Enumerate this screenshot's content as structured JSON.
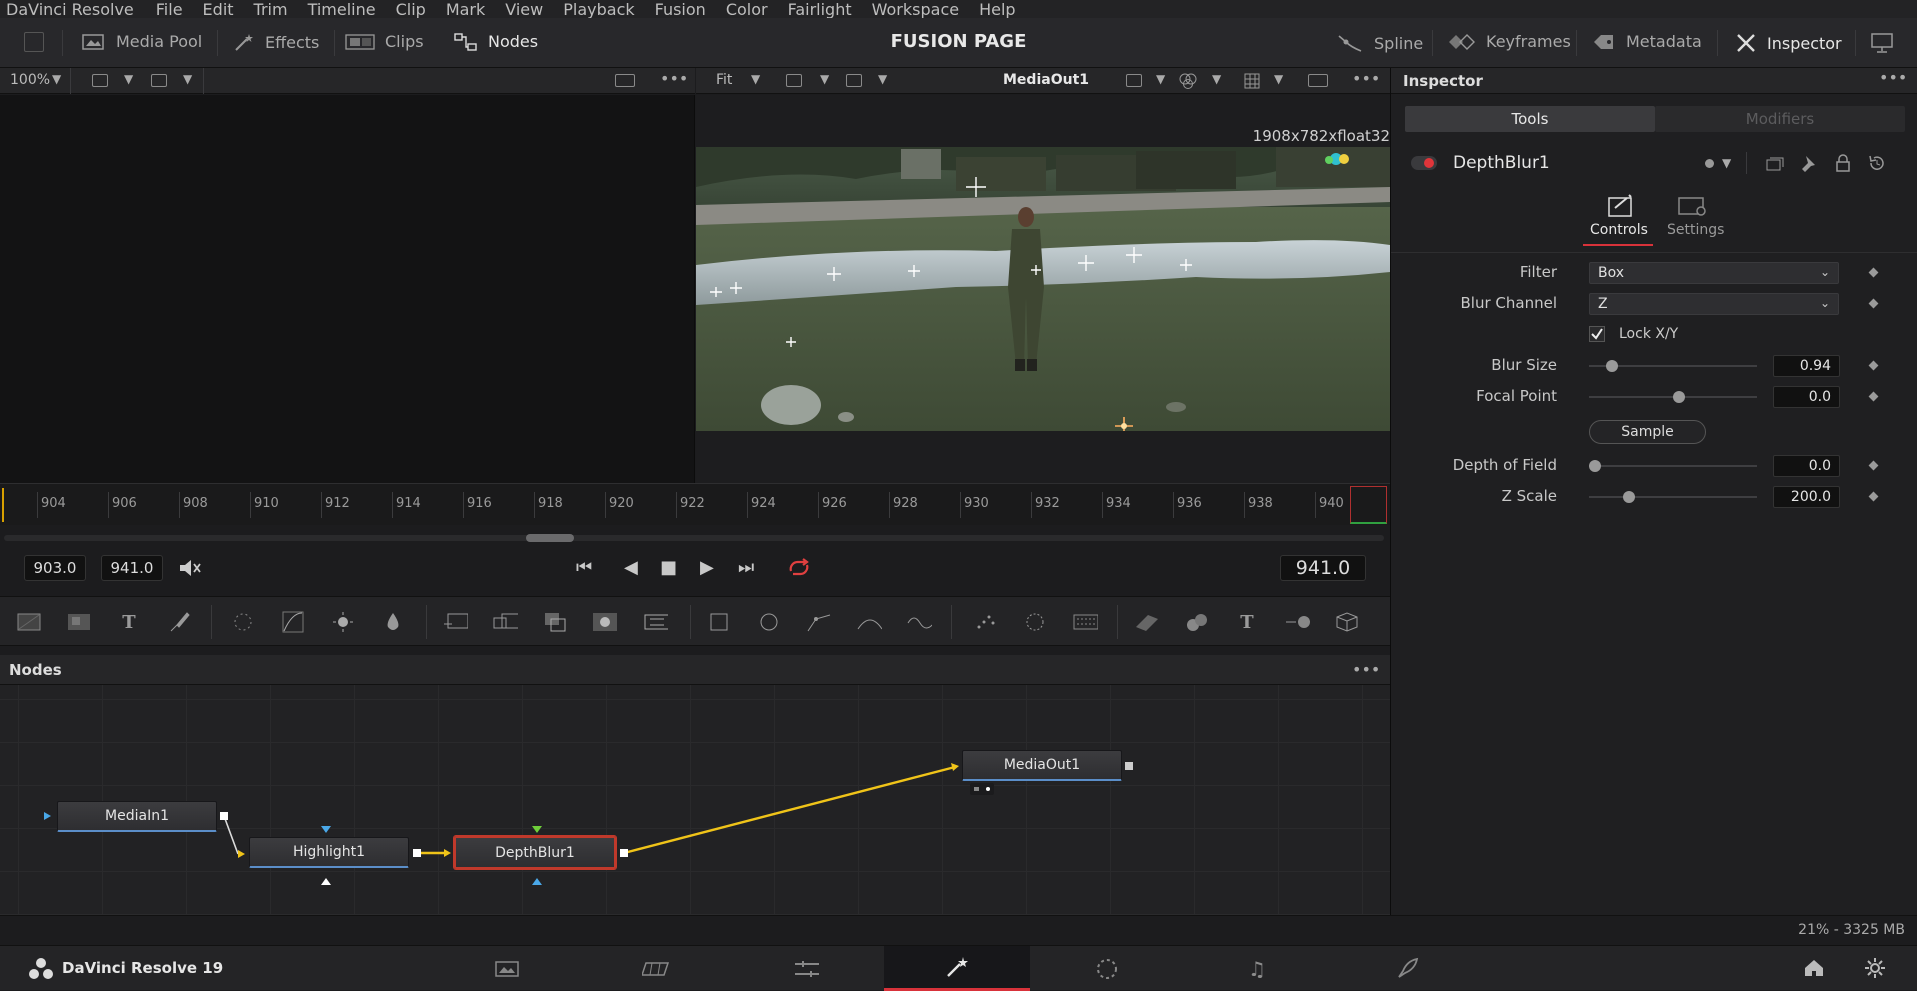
{
  "menu": [
    "DaVinci Resolve",
    "File",
    "Edit",
    "Trim",
    "Timeline",
    "Clip",
    "Mark",
    "View",
    "Playback",
    "Fusion",
    "Color",
    "Fairlight",
    "Workspace",
    "Help"
  ],
  "toolbar": {
    "left": [
      "Media Pool",
      "Effects",
      "Clips",
      "Nodes"
    ],
    "title": "FUSION PAGE",
    "right": [
      "Spline",
      "Keyframes",
      "Metadata",
      "Inspector"
    ]
  },
  "viewer_left": {
    "zoom": "100%"
  },
  "viewer_right": {
    "fit": "Fit",
    "name": "MediaOut1",
    "resolution": "1908x782xfloat32"
  },
  "ruler": {
    "ticks": [
      "904",
      "906",
      "908",
      "910",
      "912",
      "914",
      "916",
      "918",
      "920",
      "922",
      "924",
      "926",
      "928",
      "930",
      "932",
      "934",
      "936",
      "938",
      "940"
    ]
  },
  "transport": {
    "in": "903.0",
    "out": "941.0",
    "current": "941.0"
  },
  "nodes": {
    "title": "Nodes",
    "items": [
      "MediaIn1",
      "Highlight1",
      "DepthBlur1",
      "MediaOut1"
    ]
  },
  "inspector": {
    "title": "Inspector",
    "tabs": [
      "Tools",
      "Modifiers"
    ],
    "tool_name": "DepthBlur1",
    "subtabs": [
      "Controls",
      "Settings"
    ],
    "filter_label": "Filter",
    "filter_value": "Box",
    "blur_channel_label": "Blur Channel",
    "blur_channel_value": "Z",
    "lock_label": "Lock X/Y",
    "lock_checked": true,
    "blur_size_label": "Blur Size",
    "blur_size_value": "0.94",
    "focal_point_label": "Focal Point",
    "focal_point_value": "0.0",
    "sample_label": "Sample",
    "depth_label": "Depth of Field",
    "depth_value": "0.0",
    "zscale_label": "Z Scale",
    "zscale_value": "200.0",
    "slider_levels": {
      "blur_size": 0.1,
      "focal_point": 0.5,
      "depth": 0.0,
      "zscale": 0.2
    }
  },
  "status": {
    "memory": "21% - 3325 MB"
  },
  "bottom": {
    "app": "DaVinci Resolve 19",
    "active_page": "fusion"
  },
  "colors": {
    "accent_red": "#d8323a",
    "link_yellow": "#f0c419",
    "node_blue": "#5b8ec9"
  }
}
